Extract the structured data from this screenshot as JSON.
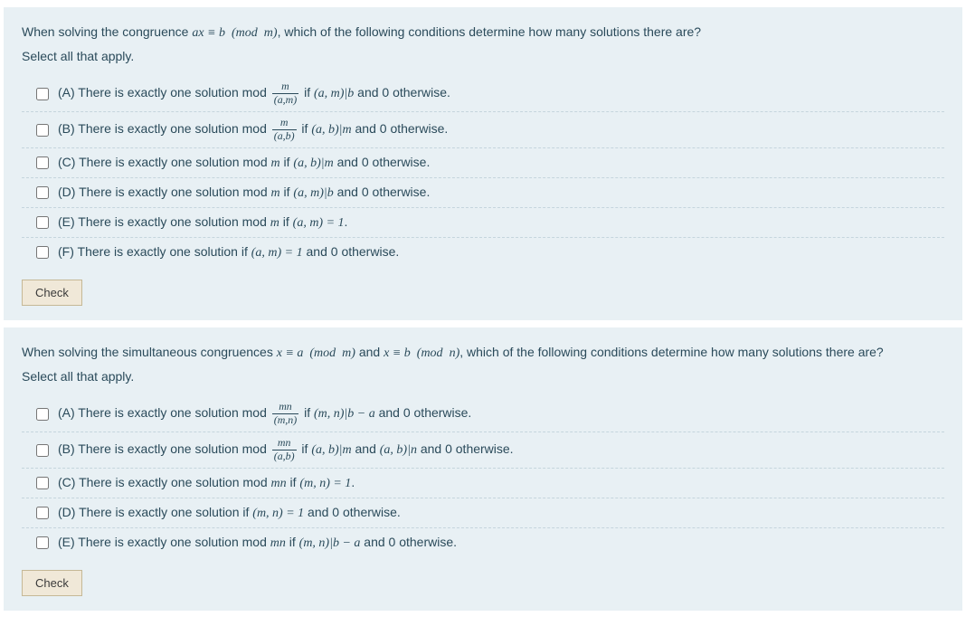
{
  "q1": {
    "prompt_pre": "When solving the congruence ",
    "prompt_math": "ax ≡ b  (mod  m)",
    "prompt_post": ", which of the following conditions determine how many solutions there are?",
    "instruction": "Select all that apply.",
    "options": {
      "A": {
        "letter": "(A)",
        "pre": " There is exactly one solution mod ",
        "frac_num": "m",
        "frac_den": "(a,m)",
        "mid": " if ",
        "cond": "(a, m)|b",
        "post": " and 0 otherwise."
      },
      "B": {
        "letter": "(B)",
        "pre": " There is exactly one solution mod ",
        "frac_num": "m",
        "frac_den": "(a,b)",
        "mid": " if ",
        "cond": "(a, b)|m",
        "post": " and 0 otherwise."
      },
      "C": {
        "letter": "(C)",
        "pre": " There is exactly one solution mod ",
        "var": "m",
        "mid": " if ",
        "cond": "(a, b)|m",
        "post": " and 0 otherwise."
      },
      "D": {
        "letter": "(D)",
        "pre": " There is exactly one solution mod ",
        "var": "m",
        "mid": " if ",
        "cond": "(a, m)|b",
        "post": " and 0 otherwise."
      },
      "E": {
        "letter": "(E)",
        "pre": " There is exactly one solution mod ",
        "var": "m",
        "mid": " if ",
        "cond": "(a, m) = 1",
        "post": "."
      },
      "F": {
        "letter": "(F)",
        "pre": " There is exactly one solution if ",
        "cond": "(a, m) = 1",
        "post": " and 0 otherwise."
      }
    },
    "check": "Check"
  },
  "q2": {
    "prompt_pre": "When solving the simultaneous congruences ",
    "prompt_math1": "x ≡ a  (mod  m)",
    "prompt_and": " and ",
    "prompt_math2": "x ≡ b  (mod  n)",
    "prompt_post": ", which of the following conditions determine how many solutions there are?",
    "instruction": "Select all that apply.",
    "options": {
      "A": {
        "letter": "(A)",
        "pre": " There is exactly one solution mod ",
        "frac_num": "mn",
        "frac_den": "(m,n)",
        "mid": " if ",
        "cond": "(m, n)|b − a",
        "post": " and 0 otherwise."
      },
      "B": {
        "letter": "(B)",
        "pre": " There is exactly one solution mod ",
        "frac_num": "mn",
        "frac_den": "(a,b)",
        "mid": " if ",
        "cond": "(a, b)|m",
        "mid2": " and ",
        "cond2": "(a, b)|n",
        "post": " and 0 otherwise."
      },
      "C": {
        "letter": "(C)",
        "pre": " There is exactly one solution mod ",
        "var": "mn",
        "mid": " if ",
        "cond": "(m, n) = 1",
        "post": "."
      },
      "D": {
        "letter": "(D)",
        "pre": " There is exactly one solution if ",
        "cond": "(m, n) = 1",
        "post": " and 0 otherwise."
      },
      "E": {
        "letter": "(E)",
        "pre": " There is exactly one solution mod ",
        "var": "mn",
        "mid": " if ",
        "cond": "(m, n)|b − a",
        "post": " and 0 otherwise."
      }
    },
    "check": "Check"
  }
}
